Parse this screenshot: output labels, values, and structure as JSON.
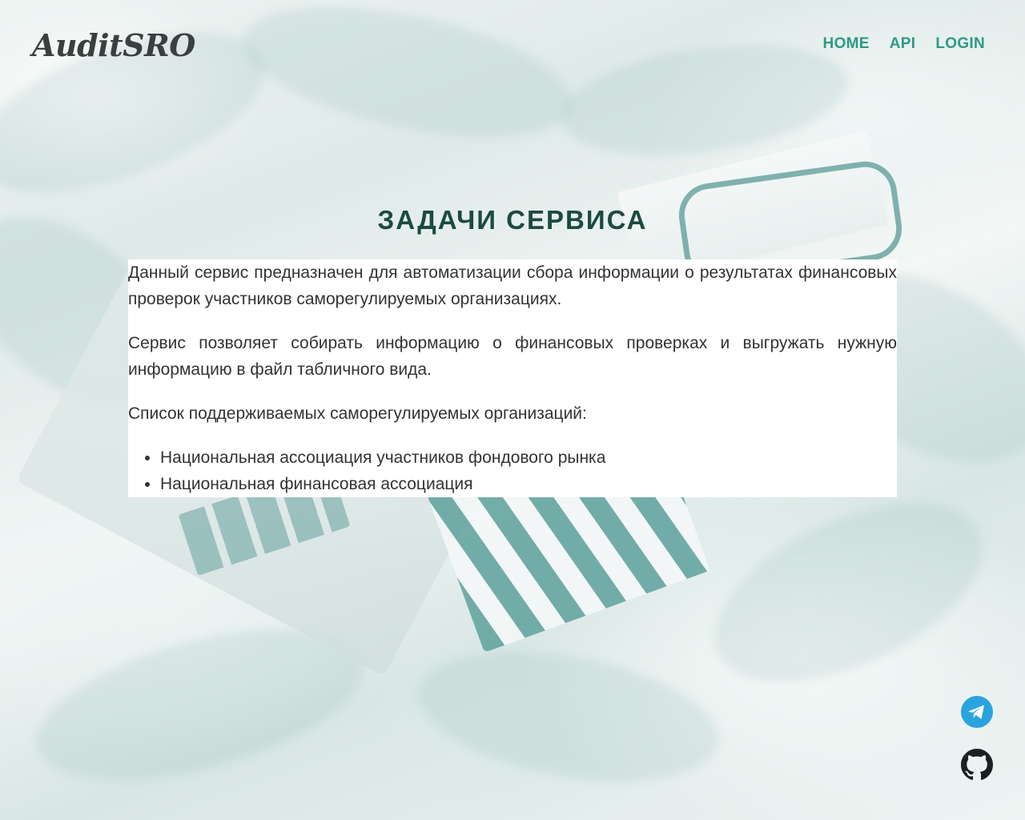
{
  "header": {
    "logo": "AuditSRO",
    "nav": [
      {
        "label": "HOME"
      },
      {
        "label": "API"
      },
      {
        "label": "LOGIN"
      }
    ]
  },
  "main": {
    "title": "ЗАДАЧИ СЕРВИСА",
    "paragraphs": [
      "Данный сервис предназначен для автоматизации сбора информации о результатах финансовых проверок участников саморегулируемых организациях.",
      "Сервис позволяет собирать информацию о финансовых проверках и выгружать нужную информацию в файл табличного вида.",
      "Список поддерживаемых саморегулируемых организаций:"
    ],
    "organizations": [
      "Национальная ассоциация участников фондового рынка",
      "Национальная финансовая ассоциация"
    ]
  },
  "social": {
    "telegram_icon": "telegram-icon",
    "github_icon": "github-icon"
  },
  "colors": {
    "nav": "#2e9a82",
    "title": "#1d4a3f",
    "telegram": "#2ba3df",
    "github": "#1b1f23"
  }
}
